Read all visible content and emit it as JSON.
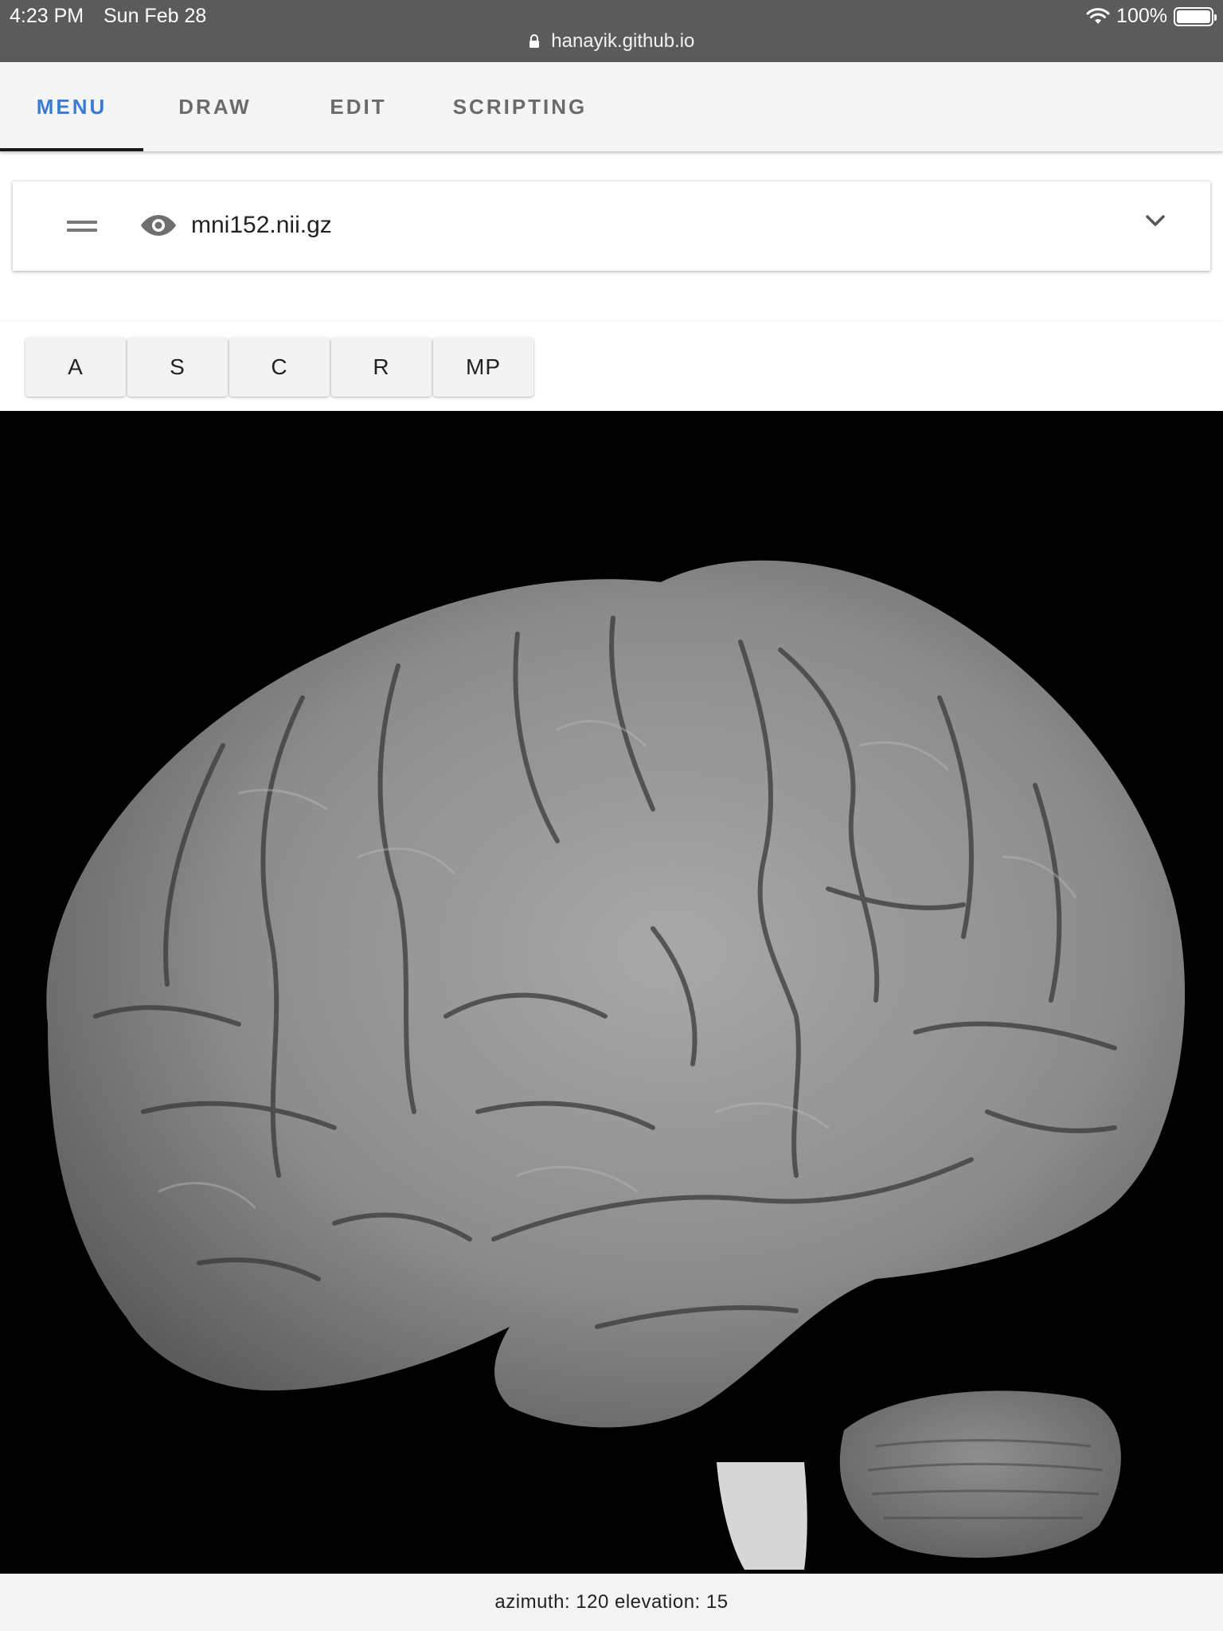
{
  "status_bar": {
    "time": "4:23 PM",
    "date": "Sun Feb 28",
    "battery_percent": "100%",
    "url": "hanayik.github.io"
  },
  "tabs": [
    {
      "label": "MENU",
      "active": true
    },
    {
      "label": "DRAW",
      "active": false
    },
    {
      "label": "EDIT",
      "active": false
    },
    {
      "label": "SCRIPTING",
      "active": false
    }
  ],
  "volume": {
    "name": "mni152.nii.gz",
    "visible": true
  },
  "view_buttons": [
    {
      "label": "A"
    },
    {
      "label": "S"
    },
    {
      "label": "C"
    },
    {
      "label": "R"
    },
    {
      "label": "MP"
    }
  ],
  "footer": {
    "text": "azimuth: 120 elevation: 15"
  },
  "colors": {
    "accent": "#3a7bd5",
    "status_bar_bg": "#5b5b5b",
    "canvas_bg": "#000000"
  }
}
